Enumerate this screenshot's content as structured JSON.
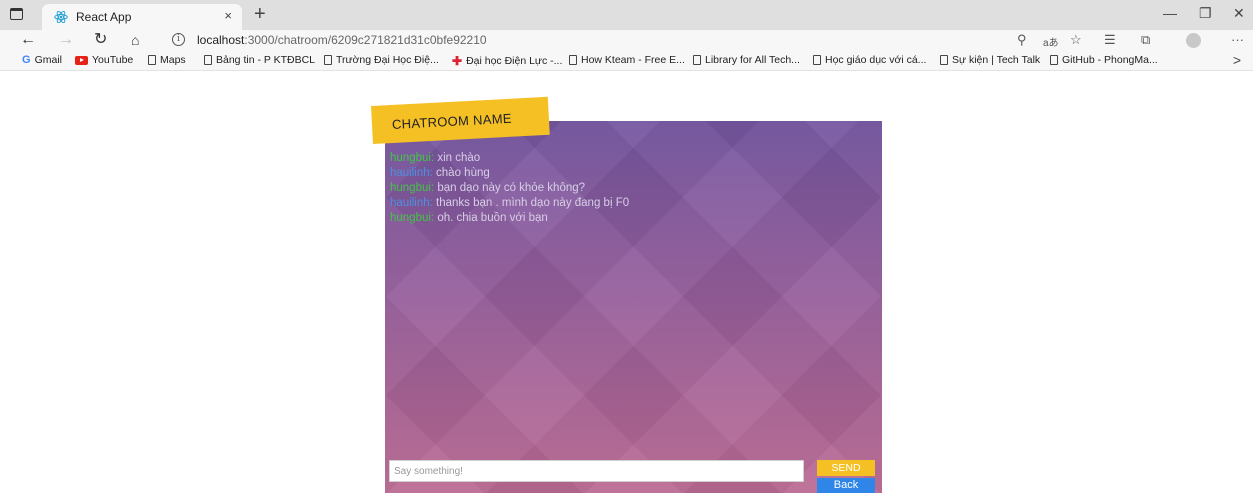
{
  "browser": {
    "tab_title": "React App",
    "tab_close": "×",
    "new_tab": "+",
    "minimize": "—",
    "restore": "❐",
    "close": "✕",
    "url_host": "localhost",
    "url_path": ":3000/chatroom/6209c271821d31c0bfe92210",
    "more": "···",
    "bookmarks_more": ">"
  },
  "bookmarks": [
    {
      "label": "Gmail",
      "icon": "gmail-icon"
    },
    {
      "label": "YouTube",
      "icon": "youtube-icon"
    },
    {
      "label": "Maps",
      "icon": "page-icon"
    },
    {
      "label": "Bảng tin - P KTĐBCL",
      "icon": "page-icon"
    },
    {
      "label": "Trường Đại Học Điệ...",
      "icon": "page-icon"
    },
    {
      "label": "Đại học Điện Lực -...",
      "icon": "cross-icon"
    },
    {
      "label": "How Kteam - Free E...",
      "icon": "page-icon"
    },
    {
      "label": "Library for All Tech...",
      "icon": "page-icon"
    },
    {
      "label": "Học giáo dục với cá...",
      "icon": "page-icon"
    },
    {
      "label": "Sự kiện | Tech Talk",
      "icon": "page-icon"
    },
    {
      "label": "GitHub - PhongMa...",
      "icon": "page-icon"
    }
  ],
  "chatroom": {
    "name": "CHATROOM NAME",
    "messages": [
      {
        "user": "hungbui:",
        "user_color": "#41c742",
        "text": " xin chào"
      },
      {
        "user": "hauilinh:",
        "user_color": "#4f8fe0",
        "text": " chào hùng"
      },
      {
        "user": "hungbui:",
        "user_color": "#41c742",
        "text": " bạn dạo này có khỏe không?"
      },
      {
        "user": "hauilinh:",
        "user_color": "#4f8fe0",
        "text": " thanks bạn . mình dạo này đang bị F0"
      },
      {
        "user": "hungbui:",
        "user_color": "#41c742",
        "text": " oh. chia buồn với bạn"
      }
    ],
    "input_placeholder": "Say something!",
    "send_label": "SEND",
    "back_label": "Back"
  },
  "colors": {
    "accent_yellow": "#f5c024",
    "back_blue": "#2f86e8",
    "gradient_top": "#7456a0",
    "gradient_bottom": "#bb6a93"
  }
}
